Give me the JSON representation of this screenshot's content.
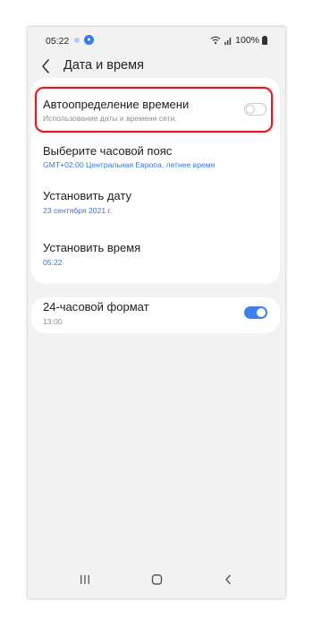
{
  "status_bar": {
    "time": "05:22",
    "battery": "100%"
  },
  "header": {
    "title": "Дата и время"
  },
  "settings": [
    {
      "title": "Автоопределение времени",
      "subtitle": "Использование даты и времени сети.",
      "toggle": "off"
    },
    {
      "title": "Выберите часовой пояс",
      "value": "GMT+02:00 Центральная Европа, летнее время"
    },
    {
      "title": "Установить дату",
      "value": "23 сентября 2021 г."
    },
    {
      "title": "Установить время",
      "value": "05:22"
    }
  ],
  "format": {
    "title": "24-часовой формат",
    "subtitle": "13:00",
    "toggle": "on"
  },
  "colors": {
    "accent": "#3e80ee",
    "value_text": "#3b73d1",
    "highlight": "#e0191e",
    "background": "#f2f2f2"
  },
  "icons": [
    "back-arrow-icon",
    "recent-apps-icon",
    "home-icon",
    "back-icon",
    "wifi-icon",
    "signal-icon",
    "battery-icon"
  ]
}
